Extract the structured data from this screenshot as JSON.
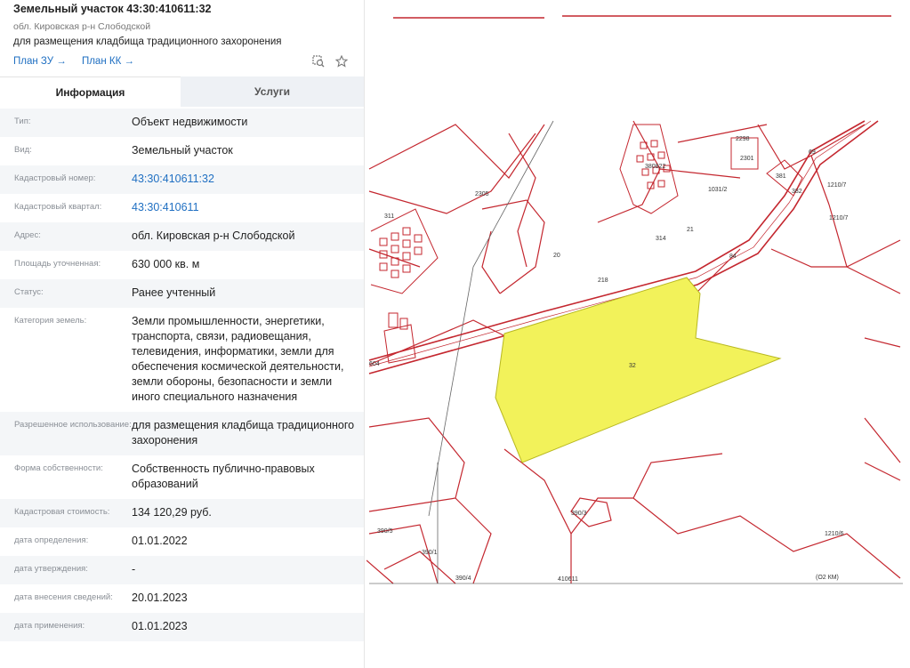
{
  "header": {
    "title": "Земельный участок 43:30:410611:32",
    "subtitle": "обл. Кировская р-н Слободской",
    "purpose": "для размещения кладбища традиционного захоронения",
    "link_plan_zu": "План ЗУ →",
    "link_plan_kk": "План КК →",
    "icons": [
      "search-area-icon",
      "star-icon"
    ]
  },
  "tabs": [
    {
      "label": "Информация",
      "active": true
    },
    {
      "label": "Услуги",
      "active": false
    }
  ],
  "rows": [
    {
      "key": "Тип:",
      "value": "Объект недвижимости"
    },
    {
      "key": "Вид:",
      "value": "Земельный участок"
    },
    {
      "key": "Кадастровый номер:",
      "value": "43:30:410611:32",
      "link": true
    },
    {
      "key": "Кадастровый квартал:",
      "value": "43:30:410611",
      "link": true
    },
    {
      "key": "Адрес:",
      "value": "обл. Кировская р-н Слободской"
    },
    {
      "key": "Площадь уточненная:",
      "value": "630 000 кв. м"
    },
    {
      "key": "Статус:",
      "value": "Ранее учтенный"
    },
    {
      "key": "Категория земель:",
      "value": "Земли промышленности, энергетики, транспорта, связи, радиовещания, телевидения, информатики, земли для обеспечения космической деятельности, земли обороны, безопасности и земли иного специального назначения"
    },
    {
      "key": "Разрешенное использование:",
      "value": "для размещения кладбища традиционного захоронения"
    },
    {
      "key": "Форма собственности:",
      "value": "Собственность публично-правовых образований"
    },
    {
      "key": "Кадастровая стоимость:",
      "value": "134 120,29 руб."
    },
    {
      "key": "дата определения:",
      "value": "01.01.2022"
    },
    {
      "key": "дата утверждения:",
      "value": "-"
    },
    {
      "key": "дата внесения сведений:",
      "value": "20.01.2023"
    },
    {
      "key": "дата применения:",
      "value": "01.01.2023"
    }
  ],
  "map": {
    "labels": [
      "32",
      "2305",
      "20",
      "314",
      "311",
      "21",
      "84",
      "69",
      "382",
      "381",
      "1210/7",
      "1210/7",
      "2301",
      "2298",
      "1031/2",
      "380822",
      "218",
      "390/3",
      "390/5",
      "390/4",
      "390/1",
      "410611",
      "1210/6",
      "(О2 КМ)",
      "604"
    ],
    "colors": {
      "parcel": "#f2f25a",
      "boundary": "#c4272f",
      "thin": "#333333"
    }
  }
}
